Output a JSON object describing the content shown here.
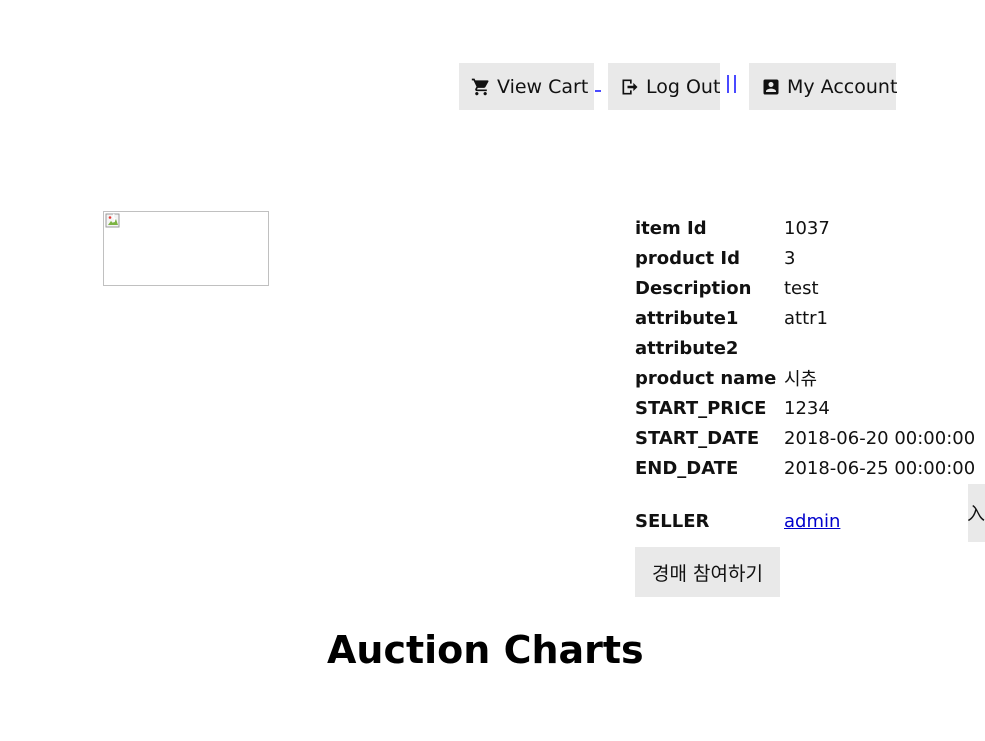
{
  "header": {
    "view_cart_label": "View Cart",
    "logout_label": "Log Out",
    "my_account_label": "My Account"
  },
  "item": {
    "rows": [
      {
        "key": "item Id",
        "value": "1037"
      },
      {
        "key": "product Id",
        "value": "3"
      },
      {
        "key": "Description",
        "value": "test"
      },
      {
        "key": "attribute1",
        "value": "attr1"
      },
      {
        "key": "attribute2",
        "value": ""
      },
      {
        "key": "product name",
        "value": "시츄"
      },
      {
        "key": "START_PRICE",
        "value": "1234"
      },
      {
        "key": "START_DATE",
        "value": "2018-06-20 00:00:00"
      },
      {
        "key": "END_DATE",
        "value": "2018-06-25 00:00:00"
      }
    ],
    "seller_key": "SELLER",
    "seller_value": "admin"
  },
  "bid_button_label": "경매 참여하기",
  "edge_tab_label": "入",
  "charts_heading": "Auction Charts",
  "icons": {
    "cart": "shopping-cart-icon",
    "logout": "logout-icon",
    "account": "account-box-icon",
    "broken_image": "broken-image-icon"
  }
}
